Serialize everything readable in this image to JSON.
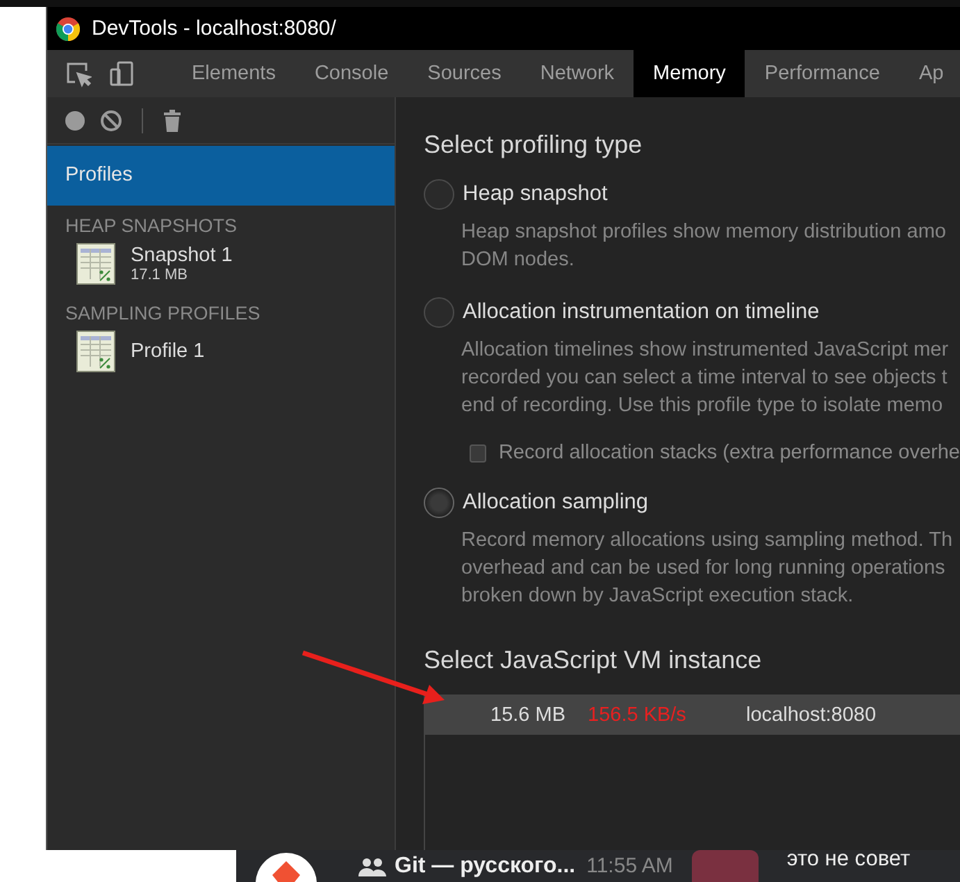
{
  "window": {
    "title": "DevTools - localhost:8080/"
  },
  "tabs": [
    {
      "label": "Elements",
      "selected": false
    },
    {
      "label": "Console",
      "selected": false
    },
    {
      "label": "Sources",
      "selected": false
    },
    {
      "label": "Network",
      "selected": false
    },
    {
      "label": "Memory",
      "selected": true
    },
    {
      "label": "Performance",
      "selected": false
    },
    {
      "label": "Ap",
      "selected": false
    }
  ],
  "sidebar": {
    "header": {
      "label": "Profiles",
      "selected": true
    },
    "groups": [
      {
        "title": "HEAP SNAPSHOTS",
        "items": [
          {
            "name": "Snapshot 1",
            "size": "17.1 MB"
          }
        ]
      },
      {
        "title": "SAMPLING PROFILES",
        "items": [
          {
            "name": "Profile 1"
          }
        ]
      }
    ]
  },
  "profiling": {
    "title": "Select profiling type",
    "options": [
      {
        "label": "Heap snapshot",
        "selected": false,
        "description": [
          "Heap snapshot profiles show memory distribution amo",
          "DOM nodes."
        ]
      },
      {
        "label": "Allocation instrumentation on timeline",
        "selected": false,
        "description": [
          "Allocation timelines show instrumented JavaScript mer",
          "recorded you can select a time interval to see objects t",
          "end of recording. Use this profile type to isolate memo"
        ],
        "option": {
          "label": "Record allocation stacks (extra performance overhe",
          "checked": false
        }
      },
      {
        "label": "Allocation sampling",
        "selected": true,
        "description": [
          "Record memory allocations using sampling method. Th",
          "overhead and can be used for long running operations",
          "broken down by JavaScript execution stack."
        ]
      }
    ]
  },
  "vm": {
    "title": "Select JavaScript VM instance",
    "instances": [
      {
        "memory": "15.6 MB",
        "rate": "156.5 KB/s",
        "url": "localhost:8080",
        "selected": true
      }
    ]
  },
  "notification": {
    "chat": "Git — русского...",
    "time": "11:55 AM",
    "message": "это не совет"
  }
}
